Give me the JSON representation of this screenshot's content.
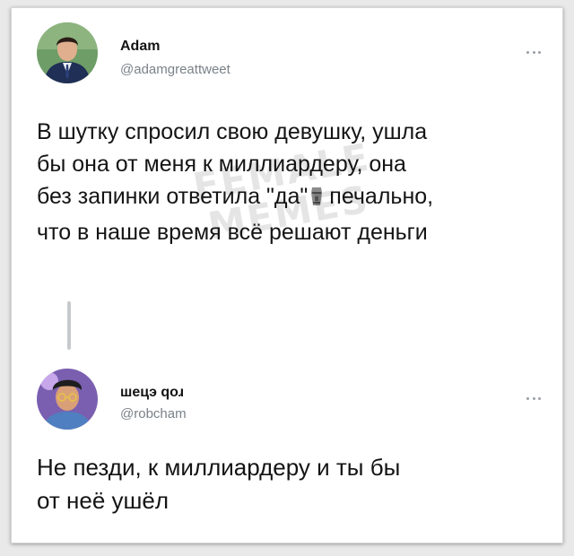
{
  "tweet1": {
    "name": "Adam",
    "handle": "@adamgreattweet",
    "avatar_icon": "person-photo-avatar",
    "text_lines": [
      "В шутку спросил свою девушку, ушла",
      "бы она от меня к миллиардеру, она"
    ],
    "line3_before": "без запинки ответила \"да\"",
    "line3_emoji": "moai-icon",
    "line3_after": "печально,",
    "line4": "что в наше время всё решают деньги"
  },
  "tweet2": {
    "name": "шецэ qoɹ",
    "handle": "@robcham",
    "avatar_icon": "cartoon-avatar",
    "text_lines": [
      "Не пезди, к миллиардеру и ты бы",
      "от неё ушёл"
    ]
  },
  "watermark": [
    "FEMALE",
    "MEMES"
  ],
  "colors": {
    "text": "#141414",
    "handle": "#7a8288",
    "thread_line": "#c7cacd",
    "background": "#e9e9e9"
  }
}
